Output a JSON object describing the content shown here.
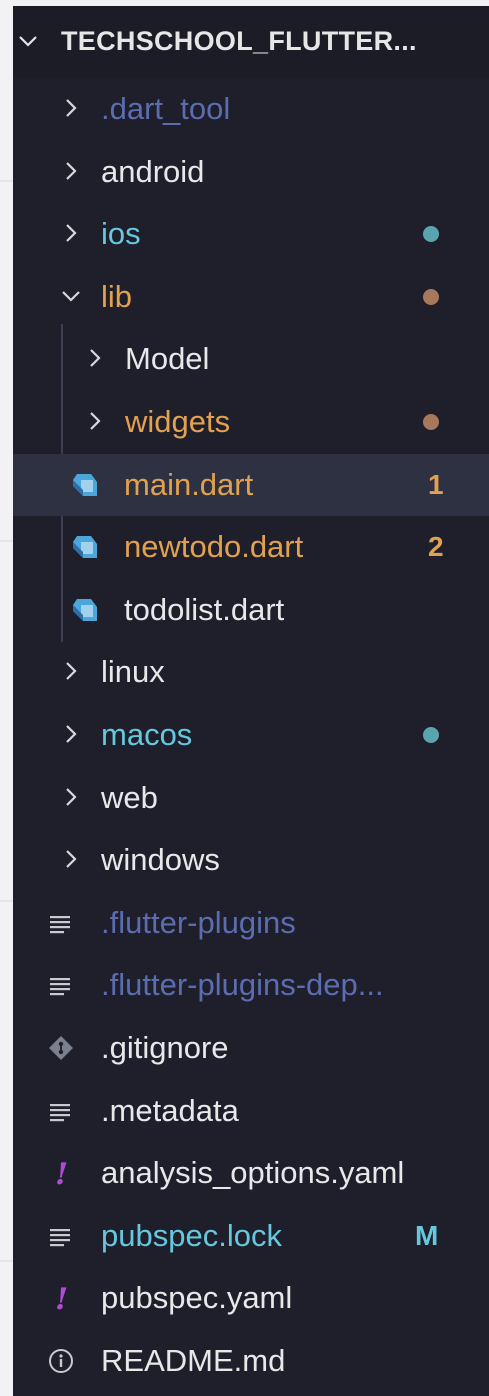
{
  "explorer": {
    "title": "TECHSCHOOL_FLUTTER...",
    "colors": {
      "panel_bg": "#1e1f2b",
      "default_text": "#e8e8e8",
      "dimmed_text": "#5b6cb0",
      "untracked_text": "#66c7dd",
      "modified_text": "#e2a14f",
      "untracked_dot": "#5aa4b0",
      "modified_dot": "#a8785a",
      "selected_row": "#2e3142"
    },
    "items": [
      {
        "label": ".dart_tool",
        "kind": "folder",
        "expanded": false,
        "indent": 0,
        "color": "dimmed"
      },
      {
        "label": "android",
        "kind": "folder",
        "expanded": false,
        "indent": 0,
        "color": "default"
      },
      {
        "label": "ios",
        "kind": "folder",
        "expanded": false,
        "indent": 0,
        "color": "untracked",
        "status": "dot"
      },
      {
        "label": "lib",
        "kind": "folder",
        "expanded": true,
        "indent": 0,
        "color": "modified",
        "status": "dot"
      },
      {
        "label": "Model",
        "kind": "folder",
        "expanded": false,
        "indent": 1,
        "color": "default"
      },
      {
        "label": "widgets",
        "kind": "folder",
        "expanded": false,
        "indent": 1,
        "color": "modified",
        "status": "dot"
      },
      {
        "label": "main.dart",
        "kind": "file",
        "icon": "dart-icon",
        "indent": 1,
        "color": "modified",
        "badge": "1",
        "selected": true
      },
      {
        "label": "newtodo.dart",
        "kind": "file",
        "icon": "dart-icon",
        "indent": 1,
        "color": "modified",
        "badge": "2"
      },
      {
        "label": "todolist.dart",
        "kind": "file",
        "icon": "dart-icon",
        "indent": 1,
        "color": "default"
      },
      {
        "label": "linux",
        "kind": "folder",
        "expanded": false,
        "indent": 0,
        "color": "default"
      },
      {
        "label": "macos",
        "kind": "folder",
        "expanded": false,
        "indent": 0,
        "color": "untracked",
        "status": "dot"
      },
      {
        "label": "web",
        "kind": "folder",
        "expanded": false,
        "indent": 0,
        "color": "default"
      },
      {
        "label": "windows",
        "kind": "folder",
        "expanded": false,
        "indent": 0,
        "color": "default"
      },
      {
        "label": ".flutter-plugins",
        "kind": "file",
        "icon": "text-lines-icon",
        "indent": 0,
        "color": "dimmed"
      },
      {
        "label": ".flutter-plugins-dep...",
        "kind": "file",
        "icon": "text-lines-icon",
        "indent": 0,
        "color": "dimmed"
      },
      {
        "label": ".gitignore",
        "kind": "file",
        "icon": "git-icon",
        "indent": 0,
        "color": "default"
      },
      {
        "label": ".metadata",
        "kind": "file",
        "icon": "text-lines-icon",
        "indent": 0,
        "color": "default"
      },
      {
        "label": "analysis_options.yaml",
        "kind": "file",
        "icon": "yaml-icon",
        "indent": 0,
        "color": "default"
      },
      {
        "label": "pubspec.lock",
        "kind": "file",
        "icon": "text-lines-icon",
        "indent": 0,
        "color": "untracked",
        "badge": "M"
      },
      {
        "label": "pubspec.yaml",
        "kind": "file",
        "icon": "yaml-icon",
        "indent": 0,
        "color": "default"
      },
      {
        "label": "README.md",
        "kind": "file",
        "icon": "info-icon",
        "indent": 0,
        "color": "default"
      }
    ]
  }
}
